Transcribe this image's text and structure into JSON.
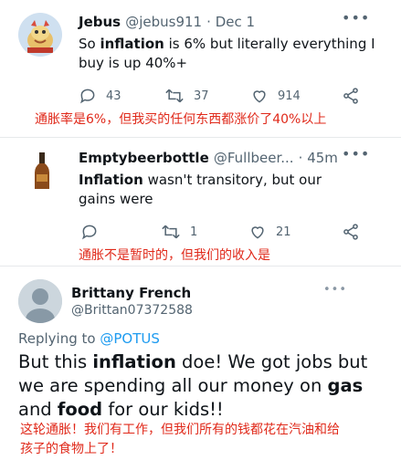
{
  "tweets": [
    {
      "name": "Jebus",
      "handle": "@jebus911",
      "time": "· Dec 1",
      "text_before": "So ",
      "text_bold": "inflation",
      "text_after": " is 6% but literally everything I buy is up 40%+",
      "replies": "43",
      "retweets": "37",
      "likes": "914",
      "translation": "通胀率是6%，但我买的任何东西都涨价了40%以上"
    },
    {
      "name": "Emptybeerbottle",
      "handle": "@Fullbeer...",
      "time": "· 45m",
      "text_bold": "Inflation",
      "text_after": " wasn't transitory, but our gains were",
      "replies": "",
      "retweets": "1",
      "likes": "21",
      "translation": "通胀不是暂时的，但我们的收入是"
    },
    {
      "name": "Brittany French",
      "handle": "@Brittan07372588",
      "replying_prefix": "Replying to ",
      "replying_to": "@POTUS",
      "text_a": "But this ",
      "text_b": "inflation",
      "text_c": " doe! We got jobs but we are spending all our money on ",
      "text_d": "gas",
      "text_e": " and ",
      "text_f": "food",
      "text_g": " for our kids!!",
      "translation_line1": "这轮通胀！我们有工作，但我们所有的钱都花在汽油和给",
      "translation_line2": "孩子的食物上了！"
    }
  ],
  "icons": [
    "avatar-dragon",
    "beer-bottle-avatar",
    "default-avatar",
    "reply-icon",
    "retweet-icon",
    "like-icon",
    "share-icon",
    "more-icon"
  ],
  "colors": {
    "translation": "#e0291a",
    "secondary": "#536471",
    "link": "#1d9bf0"
  }
}
